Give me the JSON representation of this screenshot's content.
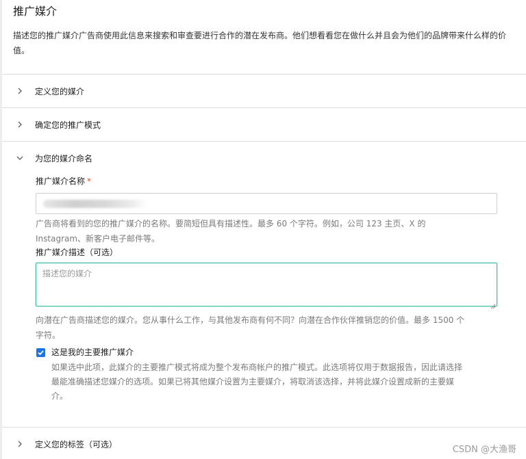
{
  "page": {
    "title": "推广媒介",
    "description": "描述您的推广媒介广告商使用此信息来搜索和审查要进行合作的潜在发布商。他们想看看您在做什么并且会为他们的品牌带来什么样的价值。"
  },
  "sections": [
    {
      "label": "定义您的媒介",
      "state": "collapsed",
      "icon": "chevron-right-icon"
    },
    {
      "label": "确定您的推广模式",
      "state": "collapsed",
      "icon": "chevron-right-icon"
    },
    {
      "label": "为您的媒介命名",
      "state": "expanded",
      "icon": "chevron-down-icon"
    },
    {
      "label": "定义您的标签（可选）",
      "state": "collapsed",
      "icon": "chevron-right-icon"
    }
  ],
  "name_field": {
    "label": "推广媒介名称",
    "required_marker": "*",
    "help_line1": "广告商将看到的您的推广媒介的名称。要简短但具有描述性。最多 60 个字符。例如，公司 123 主页、X 的",
    "help_line2": "Instagram、新客户电子邮件等。"
  },
  "description_field": {
    "label": "推广媒介描述（可选）",
    "placeholder": "描述您的媒介",
    "help_line1": "向潜在广告商描述您的媒介。您从事什么工作，与其他发布商有何不同？向潜在合作伙伴推销您的价值。最多 1500 个",
    "help_line2": "字符。"
  },
  "primary_checkbox": {
    "checked": true,
    "label": "这是我的主要推广媒介",
    "help_line1": "如果选中此项，此媒介的主要推广模式将成为整个发布商帐户的推广模式。此选项将仅用于数据报告，因此请选择",
    "help_line2": "最能准确描述您媒介的选项。如果已将其他媒介设置为主要媒介，将取消该选择，并将此媒介设置成新的主要媒",
    "help_line3": "介。"
  },
  "watermark": "CSDN @大渔哥",
  "colors": {
    "accent": "#3bbfa8",
    "checkbox": "#1a73e8",
    "required": "#e2462b"
  }
}
